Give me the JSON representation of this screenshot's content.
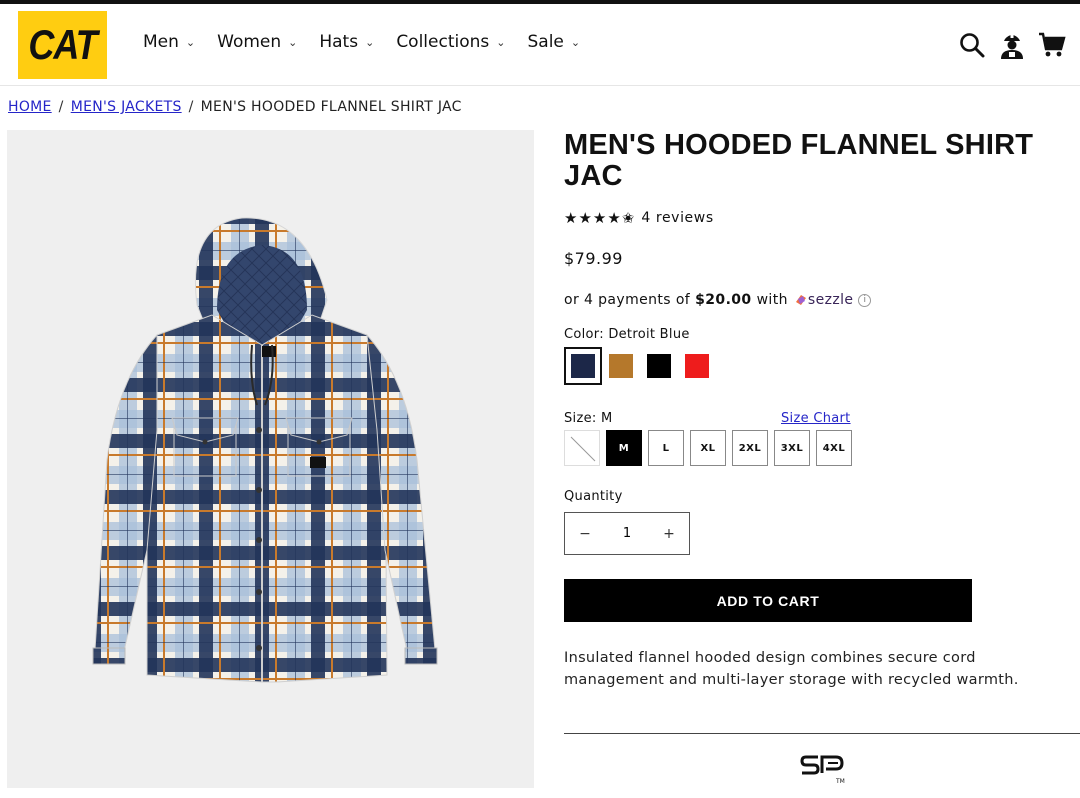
{
  "header": {
    "logo": "CAT",
    "nav": [
      {
        "label": "Men"
      },
      {
        "label": "Women"
      },
      {
        "label": "Hats"
      },
      {
        "label": "Collections"
      },
      {
        "label": "Sale"
      }
    ],
    "icons": [
      "search-icon",
      "account-icon",
      "cart-icon"
    ]
  },
  "breadcrumb": {
    "home": "HOME",
    "category": "MEN'S JACKETS",
    "current": "MEN'S HOODED FLANNEL SHIRT JAC",
    "separator": "/"
  },
  "product": {
    "title": "MEN'S HOODED FLANNEL SHIRT JAC",
    "stars": "★★★★✬",
    "rating": 4.5,
    "reviews_label": "4 reviews",
    "price": "$79.99",
    "sezzle": {
      "prefix": "or 4 payments of",
      "amount": "$20.00",
      "with": "with",
      "brand": "sezzle",
      "info": "i"
    },
    "color": {
      "label": "Color: Detroit Blue",
      "swatches": [
        {
          "name": "Detroit Blue",
          "hex": "#1c2748",
          "selected": true
        },
        {
          "name": "Brown",
          "hex": "#b5782b",
          "selected": false
        },
        {
          "name": "Black",
          "hex": "#000000",
          "selected": false
        },
        {
          "name": "Red",
          "hex": "#ee1c1c",
          "selected": false
        }
      ]
    },
    "size": {
      "label": "Size: M",
      "chart_link": "Size Chart",
      "options": [
        {
          "label": "S",
          "state": "disabled"
        },
        {
          "label": "M",
          "state": "selected"
        },
        {
          "label": "L",
          "state": "available"
        },
        {
          "label": "XL",
          "state": "available"
        },
        {
          "label": "2XL",
          "state": "available"
        },
        {
          "label": "3XL",
          "state": "available"
        },
        {
          "label": "4XL",
          "state": "available"
        }
      ]
    },
    "quantity": {
      "label": "Quantity",
      "value": "1",
      "minus": "−",
      "plus": "+"
    },
    "add_to_cart": "ADD TO CART",
    "description": "Insulated flannel hooded design combines secure cord management and multi-layer storage with recycled warmth.",
    "tech_logo": "SP",
    "tech_logo_mark": "TM"
  },
  "colors": {
    "brand_yellow": "#ffcd11",
    "link": "#2525c8",
    "image_bg": "#efefef"
  }
}
